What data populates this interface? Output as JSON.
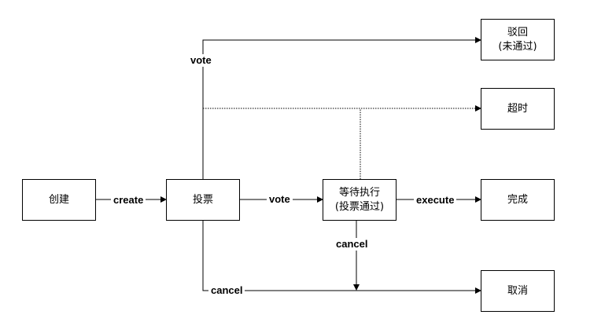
{
  "nodes": {
    "create_node": "创建",
    "vote_node": "投票",
    "pending_node": {
      "line1": "等待执行",
      "line2": "(投票通过)"
    },
    "rejected_node": {
      "line1": "驳回",
      "line2": "(未通过)"
    },
    "timeout_node": "超时",
    "done_node": "完成",
    "cancelled_node": "取消"
  },
  "edges": {
    "create": "create",
    "vote_pass": "vote",
    "vote_reject": "vote",
    "execute": "execute",
    "cancel_pending": "cancel",
    "cancel_vote": "cancel"
  },
  "colors": {
    "line": "#000000",
    "box_fill": "#ffffff"
  }
}
